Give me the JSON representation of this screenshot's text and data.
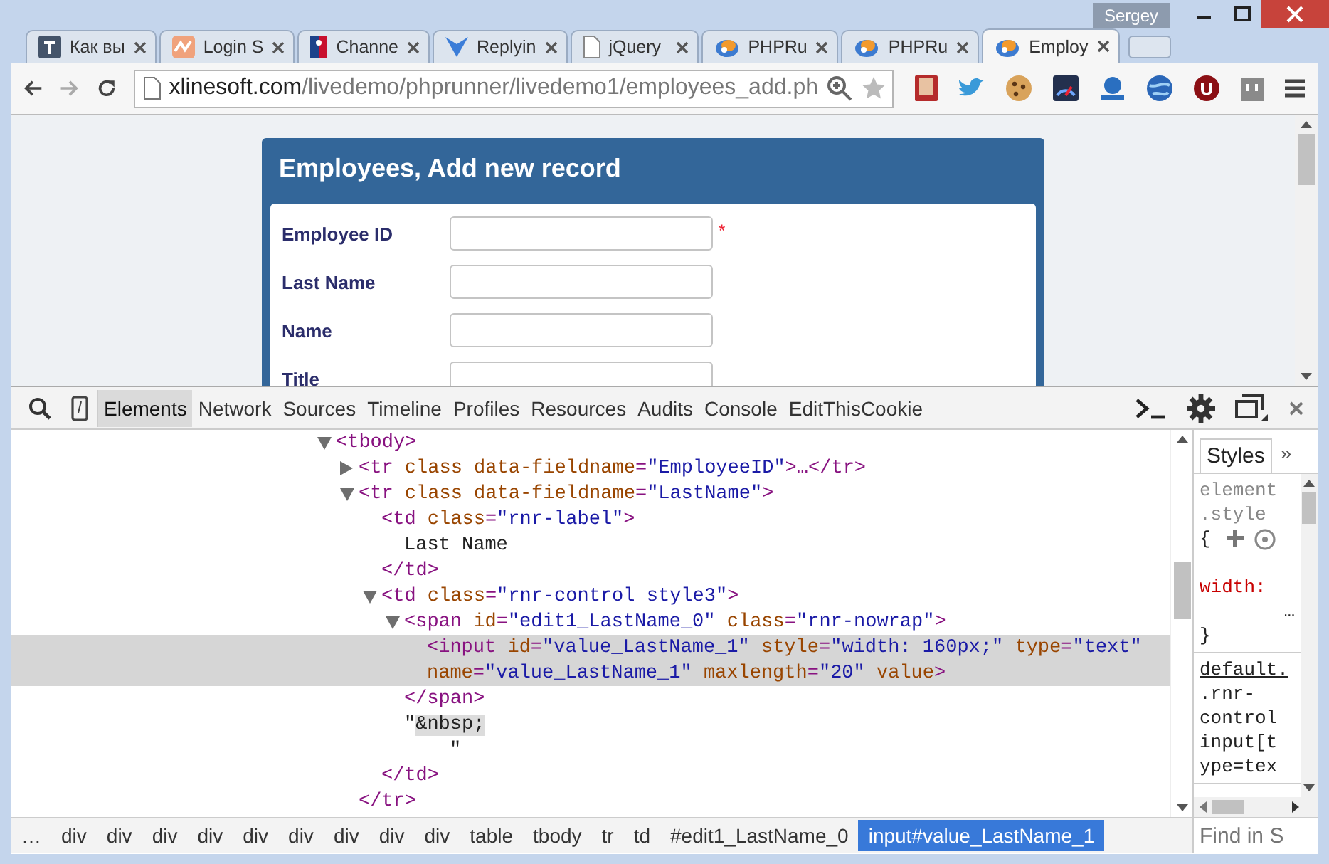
{
  "window": {
    "user": "Sergey"
  },
  "tabs": [
    {
      "label": "Как вы",
      "selected": false,
      "kind": "letter"
    },
    {
      "label": "Login S",
      "selected": false,
      "kind": "wave"
    },
    {
      "label": "Channe",
      "selected": false,
      "kind": "sport"
    },
    {
      "label": "Replyin",
      "selected": false,
      "kind": "chevron"
    },
    {
      "label": "jQuery",
      "selected": false,
      "kind": "page"
    },
    {
      "label": "PHPRu",
      "selected": false,
      "kind": "app"
    },
    {
      "label": "PHPRu",
      "selected": false,
      "kind": "app"
    },
    {
      "label": "Employ",
      "selected": true,
      "kind": "app"
    }
  ],
  "address_bar": {
    "host": "xlinesoft.com",
    "path": "/livedemo/phprunner/livedemo1/employees_add.ph"
  },
  "page": {
    "title": "Employees, Add new record",
    "fields": [
      {
        "label": "Employee ID",
        "marker": "*"
      },
      {
        "label": "Last Name"
      },
      {
        "label": "Name"
      },
      {
        "label": "Title"
      }
    ]
  },
  "devtools": {
    "tabs": [
      {
        "label": "Elements",
        "selected": true
      },
      {
        "label": "Network",
        "selected": false
      },
      {
        "label": "Sources",
        "selected": false
      },
      {
        "label": "Timeline",
        "selected": false
      },
      {
        "label": "Profiles",
        "selected": false
      },
      {
        "label": "Resources",
        "selected": false
      },
      {
        "label": "Audits",
        "selected": false
      },
      {
        "label": "Console",
        "selected": false
      },
      {
        "label": "EditThisCookie",
        "selected": false
      }
    ],
    "tree": [
      {
        "kind": "open",
        "selected": false,
        "lines": [
          "<tbody>"
        ],
        "children": [
          {
            "kind": "closed",
            "selected": false,
            "lines": [
              "<tr class data-fieldname=\"EmployeeID\">…</tr>"
            ]
          },
          {
            "kind": "open",
            "selected": false,
            "lines": [
              "<tr class data-fieldname=\"LastName\">"
            ],
            "close": "</tr>",
            "children": [
              {
                "kind": "leaf",
                "selected": false,
                "lines": [
                  "<td class=\"rnr-label\">"
                ],
                "close": "</td>",
                "children": [
                  {
                    "kind": "text",
                    "selected": false,
                    "parts": [
                      [
                        {
                          "text": "Last Name",
                          "highlighted": false
                        }
                      ]
                    ]
                  }
                ]
              },
              {
                "kind": "open",
                "selected": false,
                "lines": [
                  "<td class=\"rnr-control style3\">"
                ],
                "close": "</td>",
                "children": [
                  {
                    "kind": "open",
                    "selected": false,
                    "lines": [
                      "<span id=\"edit1_LastName_0\" class=\"rnr-nowrap\">"
                    ],
                    "close": "</span>",
                    "children": [
                      {
                        "kind": "leaf",
                        "selected": true,
                        "lines": [
                          "<input id=\"value_LastName_1\" style=\"width: 160px;\" type=\"text\"",
                          "name=\"value_LastName_1\" maxlength=\"20\" value>"
                        ]
                      }
                    ]
                  },
                  {
                    "kind": "text",
                    "selected": false,
                    "parts": [
                      [
                        {
                          "text": "\"",
                          "highlighted": false
                        },
                        {
                          "text": "&nbsp;",
                          "highlighted": true
                        }
                      ],
                      [
                        {
                          "text": "\"",
                          "highlighted": false
                        }
                      ]
                    ]
                  }
                ]
              }
            ]
          }
        ]
      }
    ],
    "styles": {
      "tabs": [
        {
          "label": "Styles",
          "selected": true
        }
      ],
      "more": "»",
      "sections": [
        {
          "lines": [
            {
              "text": "element",
              "kind": "selector"
            },
            {
              "text": ".style",
              "kind": "selector"
            },
            {
              "text": "{",
              "kind": "brace"
            },
            {
              "text": "width:",
              "kind": "property"
            },
            {
              "text": "…",
              "kind": "value"
            },
            {
              "text": "}",
              "kind": "brace"
            }
          ]
        },
        {
          "lines": [
            {
              "text": "default.",
              "kind": "source"
            },
            {
              "text": ".rnr-",
              "kind": "plain"
            },
            {
              "text": "control",
              "kind": "plain"
            },
            {
              "text": "input[t",
              "kind": "plain"
            },
            {
              "text": "ype=tex",
              "kind": "plain"
            }
          ]
        }
      ],
      "find": {
        "placeholder": "Find in S"
      }
    },
    "breadcrumbs": [
      {
        "label": "…",
        "selected": false
      },
      {
        "label": "div",
        "selected": false
      },
      {
        "label": "div",
        "selected": false
      },
      {
        "label": "div",
        "selected": false
      },
      {
        "label": "div",
        "selected": false
      },
      {
        "label": "div",
        "selected": false
      },
      {
        "label": "div",
        "selected": false
      },
      {
        "label": "div",
        "selected": false
      },
      {
        "label": "div",
        "selected": false
      },
      {
        "label": "div",
        "selected": false
      },
      {
        "label": "table",
        "selected": false
      },
      {
        "label": "tbody",
        "selected": false
      },
      {
        "label": "tr",
        "selected": false
      },
      {
        "label": "td",
        "selected": false
      },
      {
        "label": "#edit1_LastName_0",
        "selected": false
      },
      {
        "label": "input#value_LastName_1",
        "selected": true
      }
    ]
  }
}
